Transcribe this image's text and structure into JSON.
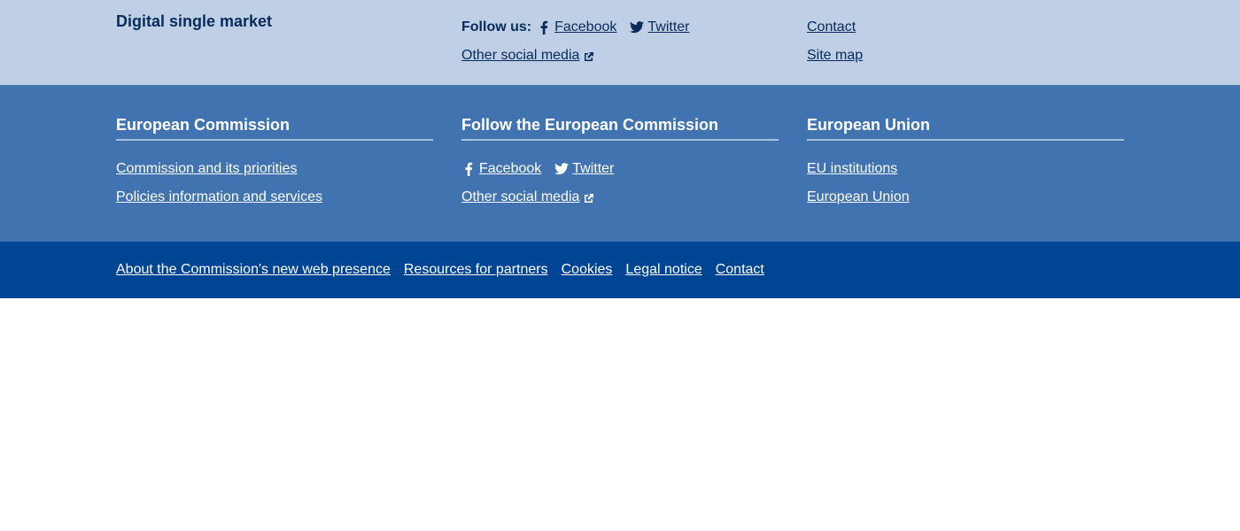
{
  "site_footer": {
    "title": "Digital single market",
    "follow_label": "Follow us:",
    "social": {
      "facebook": "Facebook",
      "twitter": "Twitter",
      "other": "Other social media"
    },
    "links": {
      "contact": "Contact",
      "site_map": "Site map"
    }
  },
  "corporate_footer": {
    "commission": {
      "heading": "European Commission",
      "links": [
        "Commission and its priorities",
        "Policies information and services"
      ]
    },
    "follow": {
      "heading": "Follow the European Commission",
      "facebook": "Facebook",
      "twitter": "Twitter",
      "other": "Other social media"
    },
    "union": {
      "heading": "European Union",
      "links": [
        "EU institutions",
        "European Union"
      ]
    }
  },
  "bottom_bar": {
    "links": [
      "About the Commission's new web presence",
      "Resources for partners",
      "Cookies",
      "Legal notice",
      "Contact"
    ]
  },
  "colors": {
    "site_footer_bg": "#bfcfe5",
    "corporate_footer_bg": "#4073af",
    "bottom_bar_bg": "#004494",
    "site_text": "#082b5c"
  },
  "icons": [
    "facebook-icon",
    "twitter-icon",
    "external-link-icon"
  ]
}
